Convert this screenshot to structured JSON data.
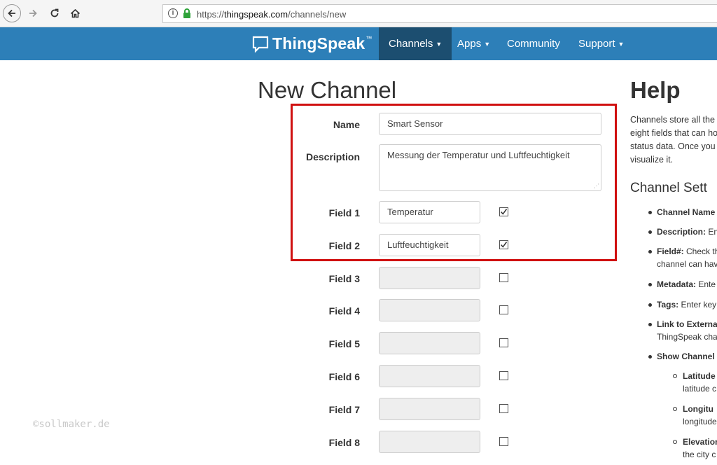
{
  "browser": {
    "url_prefix": "https://",
    "url_host": "thingspeak.com",
    "url_path": "/channels/new"
  },
  "nav": {
    "logo": "ThingSpeak",
    "logo_tm": "™",
    "items": [
      {
        "label": "Channels",
        "dropdown": true,
        "active": true
      },
      {
        "label": "Apps",
        "dropdown": true
      },
      {
        "label": "Community",
        "dropdown": false
      },
      {
        "label": "Support",
        "dropdown": true
      }
    ]
  },
  "form": {
    "title": "New Channel",
    "name_label": "Name",
    "name_value": "Smart Sensor",
    "description_label": "Description",
    "description_value": "Messung der Temperatur und Luftfeuchtigkeit",
    "fields": [
      {
        "label": "Field 1",
        "value": "Temperatur",
        "checked": true
      },
      {
        "label": "Field 2",
        "value": "Luftfeuchtigkeit",
        "checked": true
      },
      {
        "label": "Field 3",
        "value": "",
        "checked": false
      },
      {
        "label": "Field 4",
        "value": "",
        "checked": false
      },
      {
        "label": "Field 5",
        "value": "",
        "checked": false
      },
      {
        "label": "Field 6",
        "value": "",
        "checked": false
      },
      {
        "label": "Field 7",
        "value": "",
        "checked": false
      },
      {
        "label": "Field 8",
        "value": "",
        "checked": false
      }
    ]
  },
  "help": {
    "title": "Help",
    "body_lines": [
      "Channels store all the",
      "eight fields that can ho",
      "status data. Once you c",
      "visualize it."
    ],
    "settings_title": "Channel Sett",
    "items": [
      {
        "bold": "Channel Name",
        "text": ""
      },
      {
        "bold": "Description:",
        "text": " En"
      },
      {
        "bold": "Field#:",
        "text": " Check th",
        "line2": "channel can hav"
      },
      {
        "bold": "Metadata:",
        "text": " Ente"
      },
      {
        "bold": "Tags:",
        "text": " Enter key"
      },
      {
        "bold": "Link to Externa",
        "text": "",
        "line2": "ThingSpeak cha"
      },
      {
        "bold": "Show Channel",
        "text": ""
      }
    ],
    "subitems": [
      {
        "bold": "Latitude",
        "line2": "latitude c"
      },
      {
        "bold": "Longitu",
        "line2": "longitude"
      },
      {
        "bold": "Elevation",
        "line2": "the city c"
      }
    ]
  },
  "watermark": "©sollmaker.de",
  "colors": {
    "nav_bg": "#2d7fb8",
    "nav_active": "#1c4e70",
    "highlight": "#d01010"
  }
}
